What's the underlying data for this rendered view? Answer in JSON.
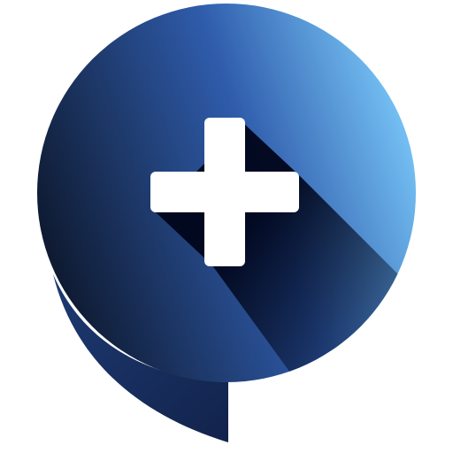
{
  "icon": {
    "name": "add-chat-bubble-icon",
    "glyph": "plus-icon",
    "colors": {
      "bubble_dark": "#0f1b33",
      "bubble_mid": "#2f5cab",
      "bubble_light": "#7fd0ff",
      "tail": "#12234b",
      "plus": "#ffffff",
      "shadow": "#00051a"
    }
  }
}
